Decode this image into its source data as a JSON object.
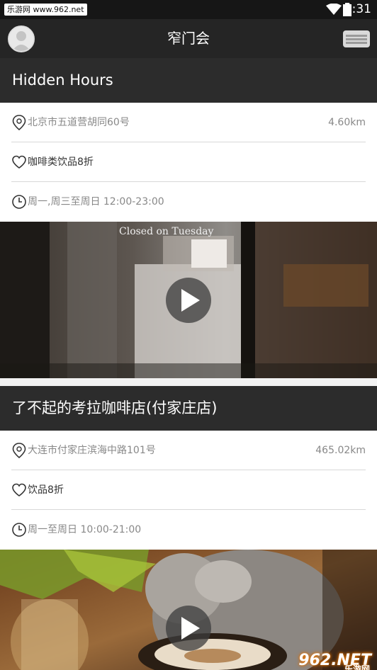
{
  "status_bar": {
    "carrier_badge": "乐游网 www.962.net",
    "time": "5:31"
  },
  "header": {
    "title": "窄门会"
  },
  "shops": [
    {
      "name": "Hidden Hours",
      "address": "北京市五道营胡同60号",
      "distance": "4.60km",
      "discount": "咖啡类饮品8折",
      "hours": "周一,周三至周日 12:00-23:00",
      "video_caption": "Closed on Tuesday"
    },
    {
      "name": "了不起的考拉咖啡店(付家庄店)",
      "address": "大连市付家庄滨海中路101号",
      "distance": "465.02km",
      "discount": "饮品8折",
      "hours": "周一至周日 10:00-21:00"
    }
  ],
  "watermark": {
    "text": "962.NET",
    "sub": "乐游网"
  },
  "icons": {
    "location": "location-pin-icon",
    "discount": "heart-icon",
    "hours": "clock-icon",
    "play": "play-icon",
    "menu": "menu-icon",
    "avatar": "user-avatar-icon"
  },
  "colors": {
    "header_bg": "#252525",
    "title_bar_bg": "#2c2c2c",
    "muted_text": "#888888"
  }
}
